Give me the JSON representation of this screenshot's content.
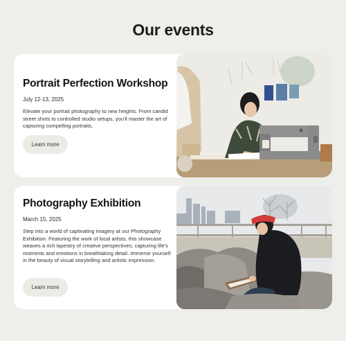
{
  "page": {
    "title": "Our events"
  },
  "events": [
    {
      "title": "Portrait Perfection Workshop",
      "date": "July 12-13, 2025",
      "description": "Elevate your portrait photography to new heights. From candid street shots to controlled studio setups, you'll master the art of capturing compelling portraits.",
      "button_label": "Learn more",
      "image": "woman-at-sewing-machine-photo"
    },
    {
      "title": "Photography Exhibition",
      "date": "March 15, 2025",
      "description": "Step into a world of captivating imagery at our Photography Exhibition. Featuring the work of local artists, this showcase weaves a rich tapestry of creative perspectives, capturing life's moments and emotions in breathtaking detail. Immerse yourself in the beauty of visual storytelling and artistic expression.",
      "button_label": "Learn more",
      "image": "woman-sketching-on-rocks-photo"
    }
  ]
}
